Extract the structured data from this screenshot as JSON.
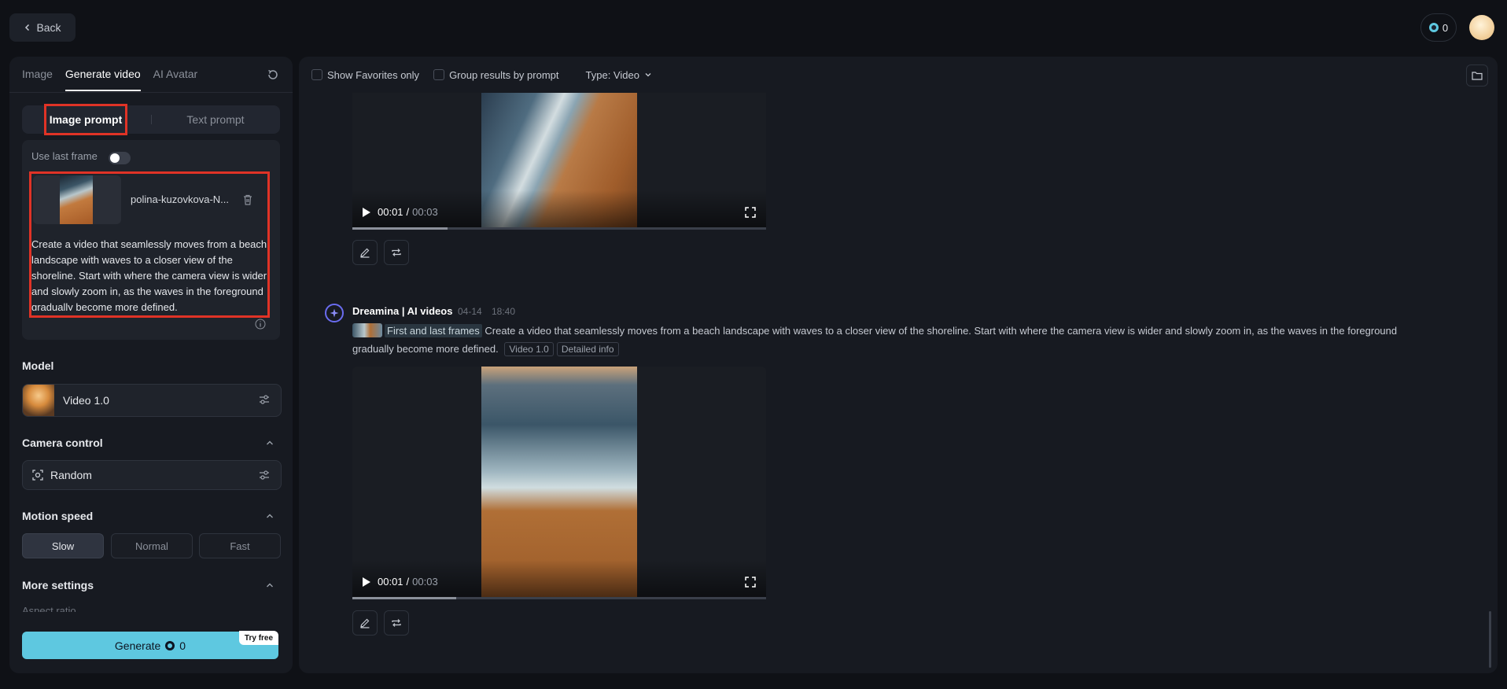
{
  "header": {
    "back_label": "Back",
    "credits": "0"
  },
  "left_panel": {
    "tabs": [
      {
        "label": "Image",
        "active": false
      },
      {
        "label": "Generate video",
        "active": true
      },
      {
        "label": "AI Avatar",
        "active": false
      }
    ],
    "prompt_mode": {
      "image_label": "Image prompt",
      "text_label": "Text prompt",
      "selected": "Image prompt"
    },
    "use_last_frame_label": "Use last frame",
    "use_last_frame_on": false,
    "file_name": "polina-kuzovkova-N...",
    "prompt_text": "Create a video that seamlessly moves from a beach landscape with waves to a closer view of the shoreline. Start with where the camera view is wider and slowly zoom in, as the waves in the foreground gradually become more defined.",
    "model_label": "Model",
    "model_name": "Video 1.0",
    "camera_label": "Camera control",
    "camera_value": "Random",
    "motion_label": "Motion speed",
    "motion_options": [
      "Slow",
      "Normal",
      "Fast"
    ],
    "motion_selected": "Slow",
    "more_settings_label": "More settings",
    "aspect_ratio_label": "Aspect ratio",
    "generate_label": "Generate",
    "generate_cost": "0",
    "try_free_label": "Try free"
  },
  "right_panel": {
    "filters": {
      "favorites_label": "Show Favorites only",
      "group_label": "Group results by prompt",
      "type_label": "Type: Video"
    },
    "video_upper": {
      "current": "00:01",
      "sep": "/",
      "duration": "00:03",
      "progress": 0.23
    },
    "message": {
      "author": "Dreamina | AI videos",
      "date": "04-14",
      "time": "18:40",
      "frames_label": "First and last frames",
      "prompt": "Create a video that seamlessly moves from a beach landscape with waves to a closer view of the shoreline. Start with where the camera view is wider and slowly zoom in, as the waves in the foreground gradually become more defined.",
      "model_tag": "Video 1.0",
      "info_tag": "Detailed info"
    },
    "video_lower": {
      "current": "00:01",
      "sep": "/",
      "duration": "00:03",
      "progress": 0.25
    }
  },
  "colors": {
    "accent": "#5ec8e0",
    "highlight_box": "#e03326",
    "background": "#0f1116",
    "panel": "#171a21"
  }
}
